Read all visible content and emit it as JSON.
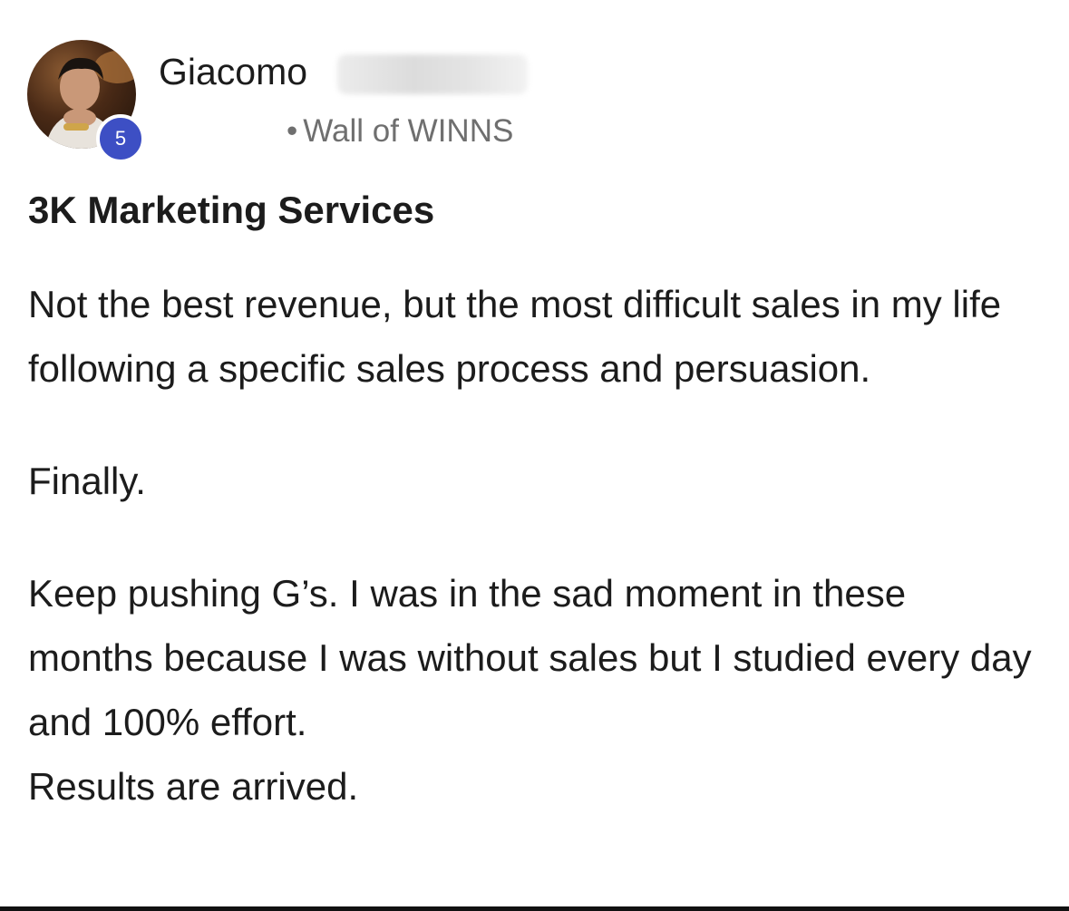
{
  "post": {
    "author_first_name": "Giacomo",
    "level": "5",
    "channel": "Wall of WINNS",
    "channel_separator": "•",
    "title": "3K Marketing Services",
    "paragraphs": [
      "Not the best revenue, but the most difficult sales in my life following a specific sales process and persuasion.",
      "Finally.",
      "Keep pushing G’s. I was in the sad moment in these months because I was without sales but I studied every day and 100% effort.",
      "Results are arrived."
    ]
  },
  "colors": {
    "badge": "#3d4fc4",
    "text": "#1c1c1c",
    "meta": "#6f6f6f"
  },
  "icons": {
    "avatar": "user-photo-avatar"
  }
}
